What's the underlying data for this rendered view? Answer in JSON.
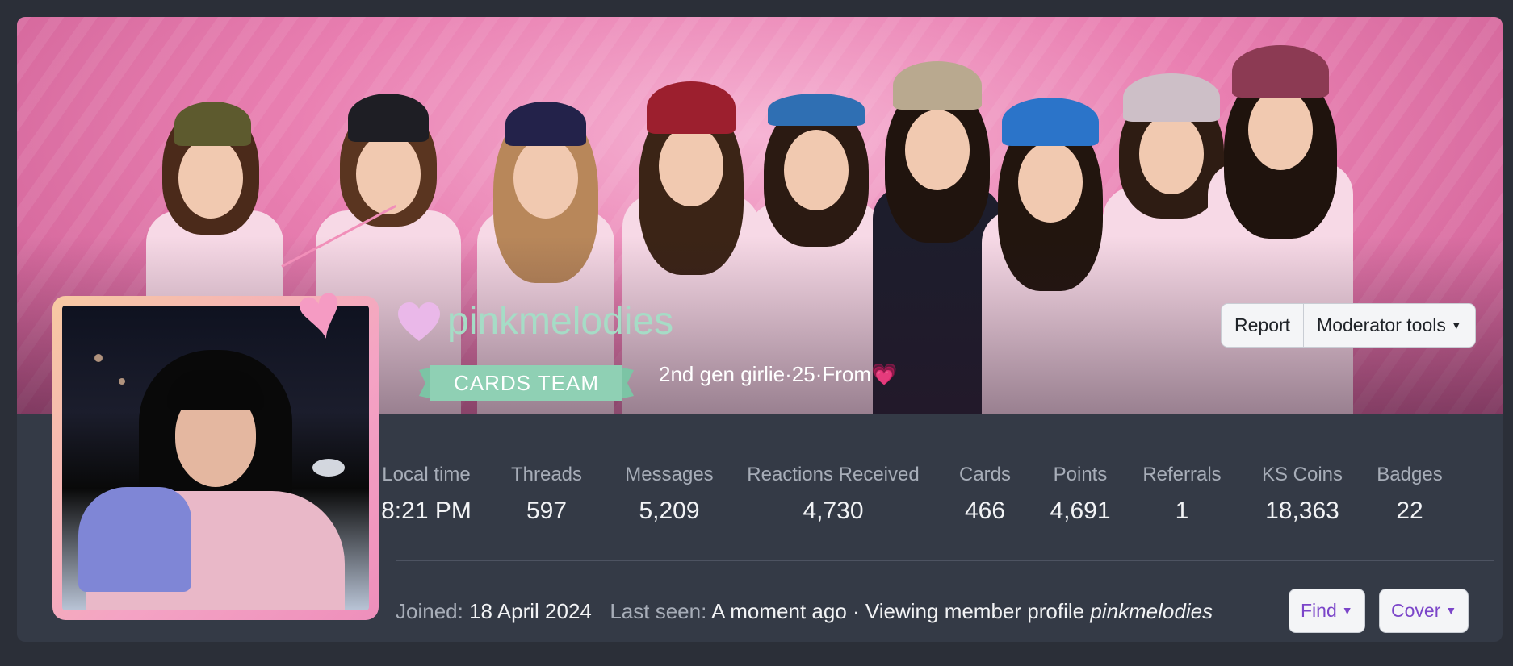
{
  "profile": {
    "username": "pinkmelodies",
    "banner_title": "CARDS TEAM",
    "tagline": "2nd gen girlie·25·From",
    "tagline_heart": "💗"
  },
  "actions": {
    "report_label": "Report",
    "moderator_tools_label": "Moderator tools",
    "find_label": "Find",
    "cover_label": "Cover"
  },
  "stats": [
    {
      "label": "Local time",
      "value": "8:21 PM"
    },
    {
      "label": "Threads",
      "value": "597"
    },
    {
      "label": "Messages",
      "value": "5,209"
    },
    {
      "label": "Reactions Received",
      "value": "4,730"
    },
    {
      "label": "Cards",
      "value": "466"
    },
    {
      "label": "Points",
      "value": "4,691"
    },
    {
      "label": "Referrals",
      "value": "1"
    },
    {
      "label": "KS Coins",
      "value": "18,363"
    },
    {
      "label": "Badges",
      "value": "22"
    }
  ],
  "meta": {
    "joined_label": "Joined:",
    "joined_value": "18 April 2024",
    "last_seen_label": "Last seen:",
    "last_seen_value": "A moment ago · Viewing member profile",
    "last_seen_profile": "pinkmelodies"
  },
  "colors": {
    "card_bg": "#343a46",
    "page_bg": "#2b2f38",
    "username": "#a6dcc6",
    "banner": "#8fd0b4",
    "link": "#7b45c9",
    "heart": "#eab8e9"
  },
  "icons": {
    "name_heart": "heart-icon",
    "caret": "caret-down-icon"
  }
}
